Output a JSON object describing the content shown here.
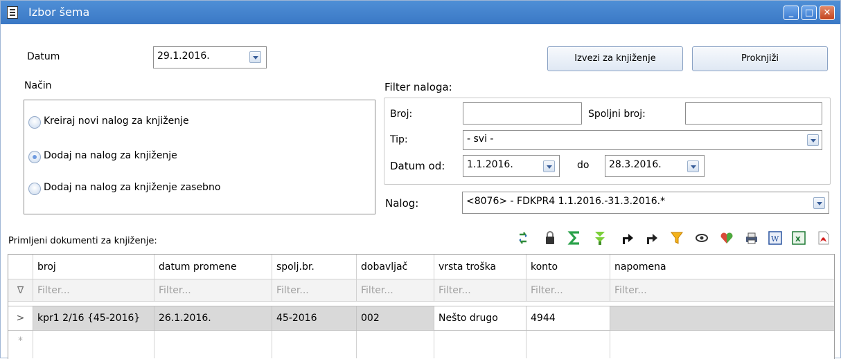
{
  "window": {
    "title": "Izbor šema"
  },
  "datum": {
    "label": "Datum",
    "value": "29.1.2016."
  },
  "buttons": {
    "izvezi": "Izvezi za knjiženje",
    "proknjizi": "Proknjiži"
  },
  "nacin": {
    "label": "Način",
    "options": [
      {
        "label": "Kreiraj novi nalog za knjiženje",
        "selected": false
      },
      {
        "label": "Dodaj na nalog za knjiženje",
        "selected": true
      },
      {
        "label": "Dodaj na nalog za knjiženje zasebno",
        "selected": false
      }
    ]
  },
  "filter": {
    "label": "Filter naloga:",
    "broj_label": "Broj:",
    "broj_value": "",
    "spoljni_label": "Spoljni broj:",
    "spoljni_value": "",
    "tip_label": "Tip:",
    "tip_value": "- svi -",
    "datum_od_label": "Datum od:",
    "datum_od_value": "1.1.2016.",
    "do_label": "do",
    "datum_do_value": "28.3.2016."
  },
  "nalog": {
    "label": "Nalog:",
    "value": "<8076> - FDKPR4 1.1.2016.-31.3.2016.*"
  },
  "documents_label": "Primljeni dokumenti za knjiženje:",
  "toolbar_icons": [
    "refresh-icon",
    "lock-icon",
    "sum-icon",
    "expand-icon",
    "export-arrow-icon",
    "redirect-icon",
    "filter-icon",
    "view-icon",
    "favorite-icon",
    "print-icon",
    "word-icon",
    "excel-icon",
    "pdf-icon"
  ],
  "table": {
    "columns": [
      "broj",
      "datum promene",
      "spolj.br.",
      "dobavljač",
      "vrsta troška",
      "konto",
      "napomena"
    ],
    "filter_placeholder": "Filter...",
    "rows": [
      {
        "broj": "kpr1 2/16 {45-2016}",
        "datum_promene": "26.1.2016.",
        "spolj_br": "45-2016",
        "dobavljac": "002",
        "vrsta_troska": "Nešto drugo",
        "konto": "4944",
        "napomena": ""
      }
    ],
    "row_marker": ">",
    "new_row_marker": "*",
    "filter_marker": "∇"
  }
}
